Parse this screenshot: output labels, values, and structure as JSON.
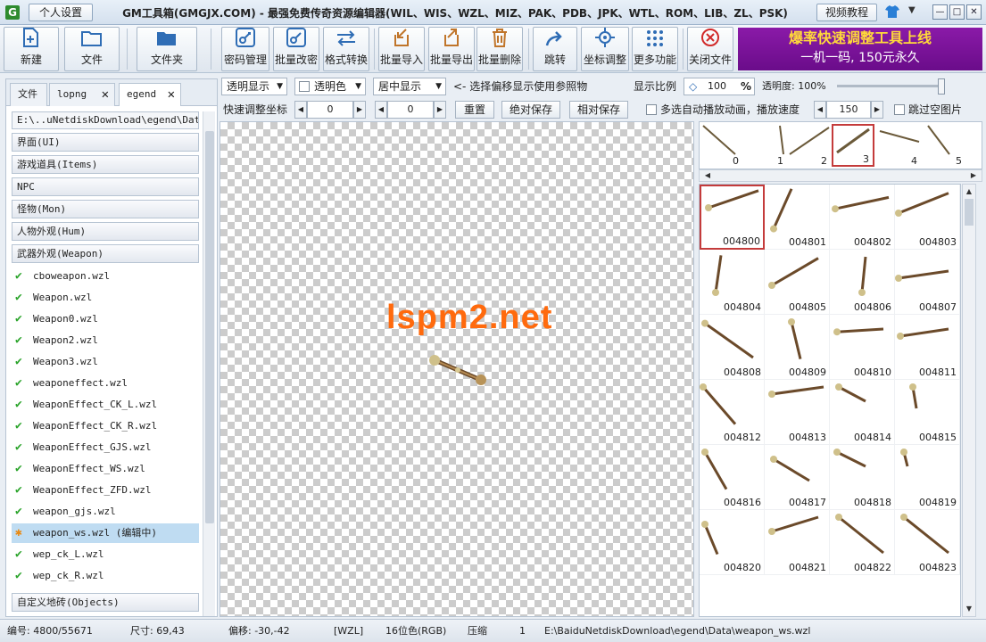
{
  "titlebar": {
    "personal_label": "个人设置",
    "title": "GM工具箱(GMGJX.COM) - 最强免费传奇资源编辑器(WIL、WIS、WZL、MIZ、PAK、PDB、JPK、WTL、ROM、LIB、ZL、PSK)",
    "video_label": "视频教程"
  },
  "toolbar": {
    "new": "新建",
    "file": "文件",
    "folder": "文件夹",
    "password": "密码管理",
    "batch_password": "批量改密",
    "convert": "格式转换",
    "import": "批量导入",
    "export": "批量导出",
    "delete": "批量删除",
    "jump": "跳转",
    "coord": "坐标调整",
    "more": "更多功能",
    "close": "关闭文件"
  },
  "banner": {
    "line1": "爆率快速调整工具上线",
    "line2": "一机一码, 150元永久"
  },
  "tabs": {
    "file": "文件",
    "lopng": "lopng",
    "egend": "egend"
  },
  "path": "E:\\..uNetdiskDownload\\egend\\Data\\",
  "categories": {
    "ui": "界面(UI)",
    "items": "游戏道具(Items)",
    "npc": "NPC",
    "mon": "怪物(Mon)",
    "hum": "人物外观(Hum)",
    "weapon": "武器外观(Weapon)",
    "objects": "自定义地砖(Objects)"
  },
  "files": [
    "cboweapon.wzl",
    "Weapon.wzl",
    "Weapon0.wzl",
    "Weapon2.wzl",
    "Weapon3.wzl",
    "weaponeffect.wzl",
    "WeaponEffect_CK_L.wzl",
    "WeaponEffect_CK_R.wzl",
    "WeaponEffect_GJS.wzl",
    "WeaponEffect_WS.wzl",
    "WeaponEffect_ZFD.wzl",
    "weapon_gjs.wzl",
    "weapon_ws.wzl (编辑中)",
    "wep_ck_L.wzl",
    "wep_ck_R.wzl"
  ],
  "options": {
    "display_mode": "透明显示",
    "transparent_color": "透明色",
    "align": "居中显示",
    "hint": "<- 选择偏移显示使用参照物",
    "scale_label": "显示比例",
    "scale_value": "100",
    "percent": "%",
    "opacity_label": "透明度: 100%",
    "opacity": 1.0,
    "quick_label": "快速调整坐标",
    "coord_x": "0",
    "coord_y": "0",
    "reset": "重置",
    "abs_save": "绝对保存",
    "rel_save": "相对保存",
    "auto_play": "多选自动播放动画，播放速度",
    "speed": "150",
    "skip_empty": "跳过空图片"
  },
  "canvas": {
    "watermark": "lspm2.net"
  },
  "frames": [
    "0",
    "1",
    "2",
    "3",
    "4",
    "5"
  ],
  "grid": [
    "004800",
    "004801",
    "004802",
    "004803",
    "004804",
    "004805",
    "004806",
    "004807",
    "004808",
    "004809",
    "004810",
    "004811",
    "004812",
    "004813",
    "004814",
    "004815",
    "004816",
    "004817",
    "004818",
    "004819",
    "004820",
    "004821",
    "004822",
    "004823"
  ],
  "status": {
    "index": "编号: 4800/55671",
    "size": "尺寸: 69,43",
    "offset": "偏移: -30,-42",
    "format": "[WZL]",
    "color": "16位色(RGB)",
    "compress": "压缩",
    "compress_val": "1",
    "path": "E:\\BaiduNetdiskDownload\\egend\\Data\\weapon_ws.wzl"
  },
  "colors": {
    "accent": "#2f6db5",
    "banner_bg": "#7a129a",
    "watermark": "#ff6a0d",
    "selection": "#c43b3b"
  },
  "icons": [
    "app-icon",
    "new-file-icon",
    "open-file-icon",
    "folder-icon",
    "key-icon",
    "batch-key-icon",
    "convert-icon",
    "import-icon",
    "export-icon",
    "trash-icon",
    "jump-icon",
    "crosshair-icon",
    "dots-icon",
    "close-circle-icon",
    "check-icon",
    "edit-star-icon"
  ]
}
